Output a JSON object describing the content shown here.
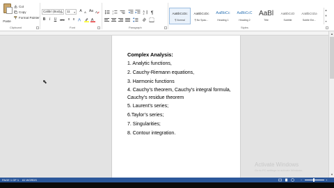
{
  "ribbon": {
    "clipboard": {
      "paste_label": "Paste",
      "cut_label": "Cut",
      "copy_label": "Copy",
      "format_painter_label": "Format Painter",
      "group_label": "Clipboard"
    },
    "font": {
      "font_name": "Calibri (Body)",
      "font_size": "11",
      "grow_font": "A",
      "shrink_font": "A",
      "case": "Aa",
      "bold": "B",
      "italic": "I",
      "underline": "U",
      "strikethrough": "abc",
      "subscript": "x",
      "superscript": "x",
      "font_color": "A",
      "group_label": "Font"
    },
    "paragraph": {
      "group_label": "Paragraph"
    },
    "styles": {
      "items": [
        {
          "sample": "AaBbCcDc",
          "name": "¶ Normal"
        },
        {
          "sample": "AaBbCcDc",
          "name": "¶ No Spac..."
        },
        {
          "sample": "AaBbCc",
          "name": "Heading 1"
        },
        {
          "sample": "AaBbCcC",
          "name": "Heading 2"
        },
        {
          "sample": "AaBl",
          "name": "Title"
        },
        {
          "sample": "AaBbCcD",
          "name": "Subtitle"
        },
        {
          "sample": "AaBbCcDa",
          "name": "Subtle Em..."
        },
        {
          "sample": "AaBbCcDa",
          "name": "Emphasis"
        }
      ],
      "group_label": "Styles"
    }
  },
  "document": {
    "heading": "Complex Analysis:",
    "items": [
      "1. Analytic functions,",
      "2. Cauchy-Riemann equations,",
      "3. Harmonic functions",
      "4. Cauchy’s theorem, Cauchy’s integral formula, Cauchy’s residue theorem",
      "5. Laurent’s series;",
      "6.Taylor’s series;",
      "7. Singularities;",
      "8. Contour integration."
    ]
  },
  "watermark": {
    "title": "Activate Windows",
    "subtitle": "Go to PC settings to activate Windows."
  },
  "statusbar": {
    "page": "PAGE 1 OF 1",
    "words": "61 WORDS"
  },
  "colors": {
    "statusbar": "#2b579a",
    "selected_style": "#eaf2fb",
    "font_color_bar": "#e02020",
    "highlight_bar": "#ffff00"
  }
}
